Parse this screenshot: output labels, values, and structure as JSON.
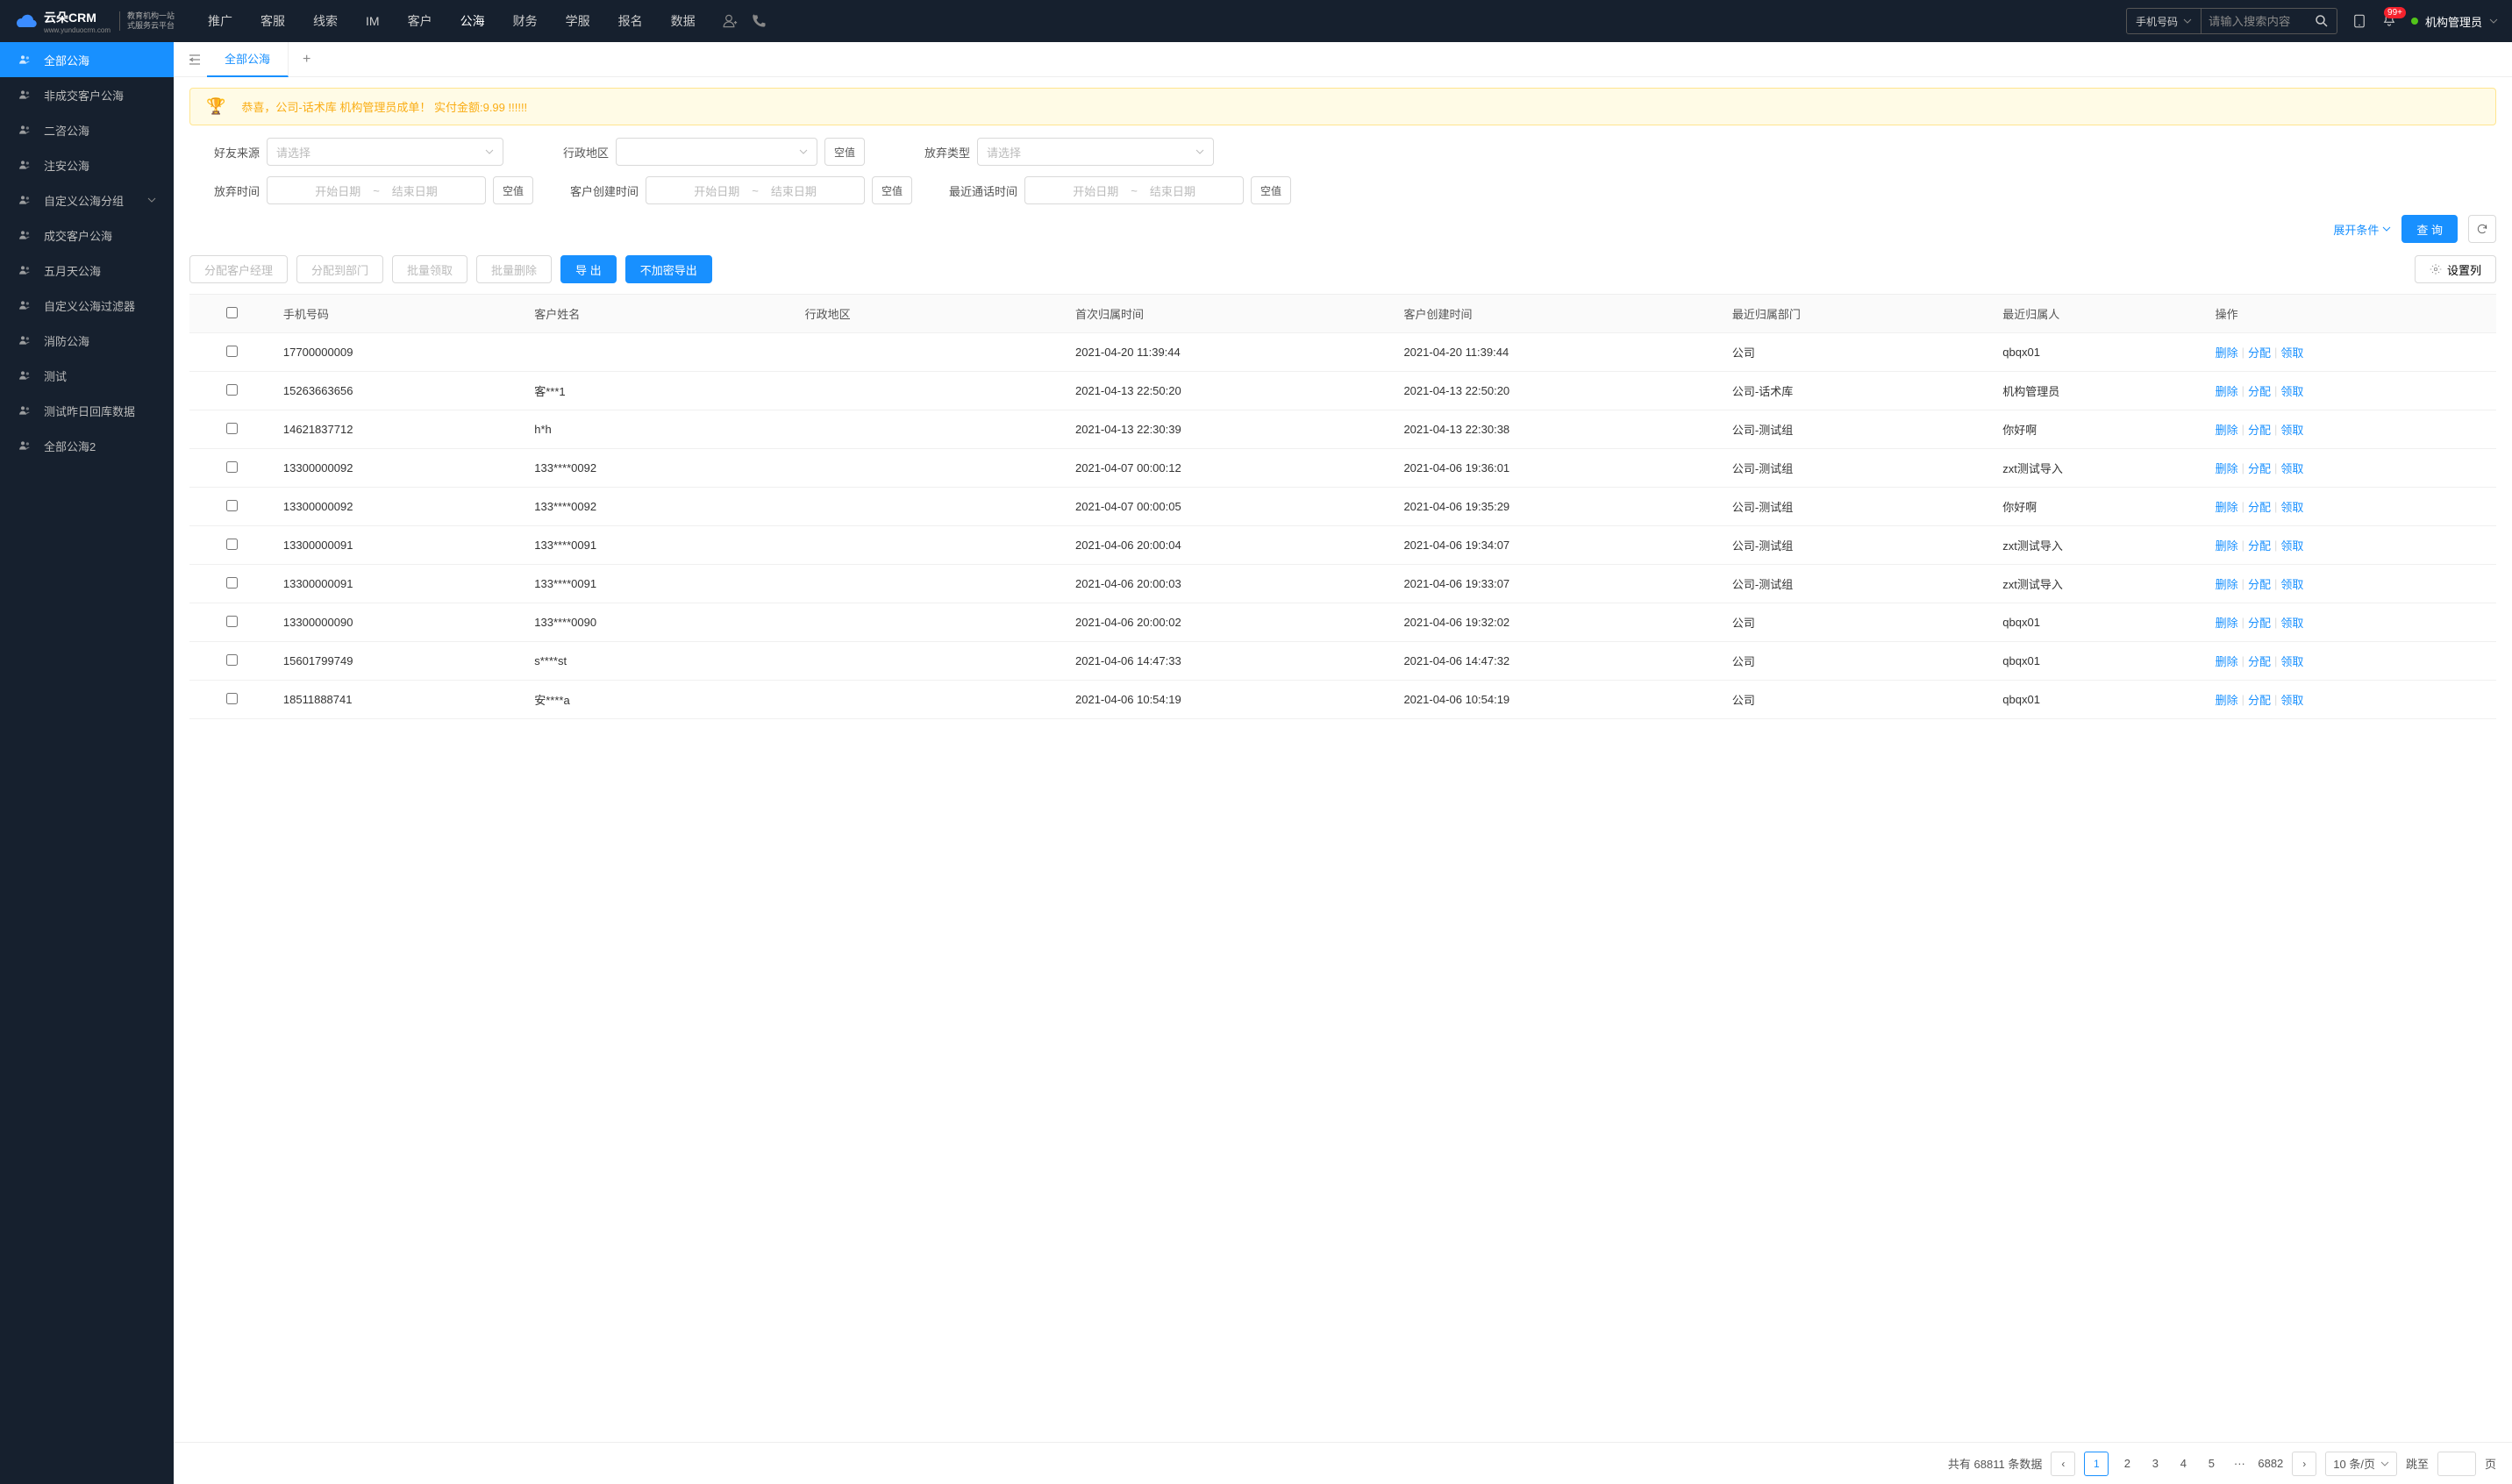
{
  "header": {
    "brand": "云朵CRM",
    "brand_url": "www.yunduocrm.com",
    "brand_sub1": "教育机构一站",
    "brand_sub2": "式服务云平台",
    "nav": [
      "推广",
      "客服",
      "线索",
      "IM",
      "客户",
      "公海",
      "财务",
      "学服",
      "报名",
      "数据"
    ],
    "nav_active_index": 5,
    "search_type": "手机号码",
    "search_placeholder": "请输入搜索内容",
    "notif_badge": "99+",
    "user_name": "机构管理员"
  },
  "sidebar": {
    "items": [
      {
        "label": "全部公海",
        "active": true
      },
      {
        "label": "非成交客户公海"
      },
      {
        "label": "二咨公海"
      },
      {
        "label": "注安公海"
      },
      {
        "label": "自定义公海分组",
        "expandable": true
      },
      {
        "label": "成交客户公海"
      },
      {
        "label": "五月天公海"
      },
      {
        "label": "自定义公海过滤器"
      },
      {
        "label": "消防公海"
      },
      {
        "label": "测试"
      },
      {
        "label": "测试昨日回库数据"
      },
      {
        "label": "全部公海2"
      }
    ]
  },
  "tabs": {
    "items": [
      "全部公海"
    ],
    "active_index": 0
  },
  "banner": {
    "text": "恭喜，公司-话术库 机构管理员成单！ 实付金额:9.99 !!!!!!"
  },
  "filters": {
    "source_label": "好友来源",
    "region_label": "行政地区",
    "abandon_type_label": "放弃类型",
    "abandon_time_label": "放弃时间",
    "create_time_label": "客户创建时间",
    "last_call_label": "最近通话时间",
    "select_placeholder": "请选择",
    "date_start_placeholder": "开始日期",
    "date_end_placeholder": "结束日期",
    "null_label": "空值",
    "expand_label": "展开条件",
    "query_label": "查 询"
  },
  "actions": {
    "assign_mgr": "分配客户经理",
    "assign_dept": "分配到部门",
    "batch_receive": "批量领取",
    "batch_delete": "批量删除",
    "export": "导 出",
    "export_plain": "不加密导出",
    "set_columns": "设置列"
  },
  "table": {
    "columns": [
      "手机号码",
      "客户姓名",
      "行政地区",
      "首次归属时间",
      "客户创建时间",
      "最近归属部门",
      "最近归属人",
      "操作"
    ],
    "op_delete": "删除",
    "op_assign": "分配",
    "op_receive": "领取",
    "rows": [
      {
        "phone": "17700000009",
        "name": "",
        "region": "",
        "first_time": "2021-04-20 11:39:44",
        "create_time": "2021-04-20 11:39:44",
        "dept": "公司",
        "owner": "qbqx01"
      },
      {
        "phone": "15263663656",
        "name": "客***1",
        "region": "",
        "first_time": "2021-04-13 22:50:20",
        "create_time": "2021-04-13 22:50:20",
        "dept": "公司-话术库",
        "owner": "机构管理员"
      },
      {
        "phone": "14621837712",
        "name": "h*h",
        "region": "",
        "first_time": "2021-04-13 22:30:39",
        "create_time": "2021-04-13 22:30:38",
        "dept": "公司-测试组",
        "owner": "你好啊"
      },
      {
        "phone": "13300000092",
        "name": "133****0092",
        "region": "",
        "first_time": "2021-04-07 00:00:12",
        "create_time": "2021-04-06 19:36:01",
        "dept": "公司-测试组",
        "owner": "zxt测试导入"
      },
      {
        "phone": "13300000092",
        "name": "133****0092",
        "region": "",
        "first_time": "2021-04-07 00:00:05",
        "create_time": "2021-04-06 19:35:29",
        "dept": "公司-测试组",
        "owner": "你好啊"
      },
      {
        "phone": "13300000091",
        "name": "133****0091",
        "region": "",
        "first_time": "2021-04-06 20:00:04",
        "create_time": "2021-04-06 19:34:07",
        "dept": "公司-测试组",
        "owner": "zxt测试导入"
      },
      {
        "phone": "13300000091",
        "name": "133****0091",
        "region": "",
        "first_time": "2021-04-06 20:00:03",
        "create_time": "2021-04-06 19:33:07",
        "dept": "公司-测试组",
        "owner": "zxt测试导入"
      },
      {
        "phone": "13300000090",
        "name": "133****0090",
        "region": "",
        "first_time": "2021-04-06 20:00:02",
        "create_time": "2021-04-06 19:32:02",
        "dept": "公司",
        "owner": "qbqx01"
      },
      {
        "phone": "15601799749",
        "name": "s****st",
        "region": "",
        "first_time": "2021-04-06 14:47:33",
        "create_time": "2021-04-06 14:47:32",
        "dept": "公司",
        "owner": "qbqx01"
      },
      {
        "phone": "18511888741",
        "name": "安****a",
        "region": "",
        "first_time": "2021-04-06 10:54:19",
        "create_time": "2021-04-06 10:54:19",
        "dept": "公司",
        "owner": "qbqx01"
      }
    ]
  },
  "pagination": {
    "total_prefix": "共有",
    "total": "68811",
    "total_suffix": "条数据",
    "pages": [
      "1",
      "2",
      "3",
      "4",
      "5"
    ],
    "ellipsis": "···",
    "last_page": "6882",
    "page_size": "10 条/页",
    "jump_label": "跳至",
    "page_suffix": "页"
  }
}
